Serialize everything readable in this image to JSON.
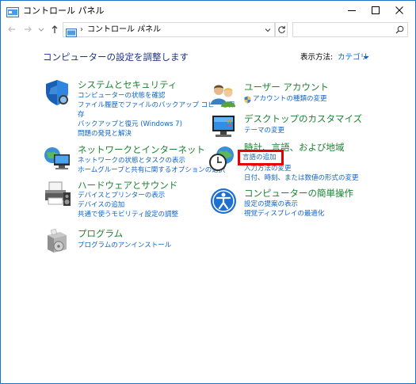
{
  "window": {
    "title": "コントロール パネル"
  },
  "address": {
    "crumb": "コントロール パネル",
    "separator_left": "›",
    "separator_right": "›"
  },
  "search": {
    "placeholder": ""
  },
  "header": {
    "title": "コンピューターの設定を調整します",
    "view_by_label": "表示方法:",
    "view_by_value": "カテゴリ"
  },
  "categories": [
    {
      "title": "システムとセキュリティ",
      "icon": "shield-icon",
      "links": [
        "コンピューターの状態を確認",
        "ファイル履歴でファイルのバックアップ コピーを保",
        "存",
        "バックアップと復元 (Windows 7)",
        "問題の発見と解決"
      ]
    },
    {
      "title": "ネットワークとインターネット",
      "icon": "network-icon",
      "links": [
        "ネットワークの状態とタスクの表示",
        "ホームグループと共有に関するオプションの選択"
      ]
    },
    {
      "title": "ハードウェアとサウンド",
      "icon": "printer-icon",
      "links": [
        "デバイスとプリンターの表示",
        "デバイスの追加",
        "共通で使うモビリティ設定の調整"
      ]
    },
    {
      "title": "プログラム",
      "icon": "programs-icon",
      "links": [
        "プログラムのアンインストール"
      ]
    },
    {
      "title": "ユーザー アカウント",
      "icon": "users-icon",
      "links": [
        "アカウントの種類の変更"
      ]
    },
    {
      "title": "デスクトップのカスタマイズ",
      "icon": "desktop-icon",
      "links": [
        "テーマの変更"
      ]
    },
    {
      "title": "時計、言語、および地域",
      "icon": "clock-globe-icon",
      "links": [
        "言語の追加",
        "入力方法の変更",
        "日付、時刻、または数値の形式の変更"
      ]
    },
    {
      "title": "コンピューターの簡単操作",
      "icon": "ease-of-access-icon",
      "links": [
        "設定の提案の表示",
        "視覚ディスプレイの最適化"
      ]
    }
  ],
  "colors": {
    "accent": "#1064c8",
    "category_title": "#1e8232",
    "heading": "#1e3287",
    "highlight": "#e60000"
  }
}
